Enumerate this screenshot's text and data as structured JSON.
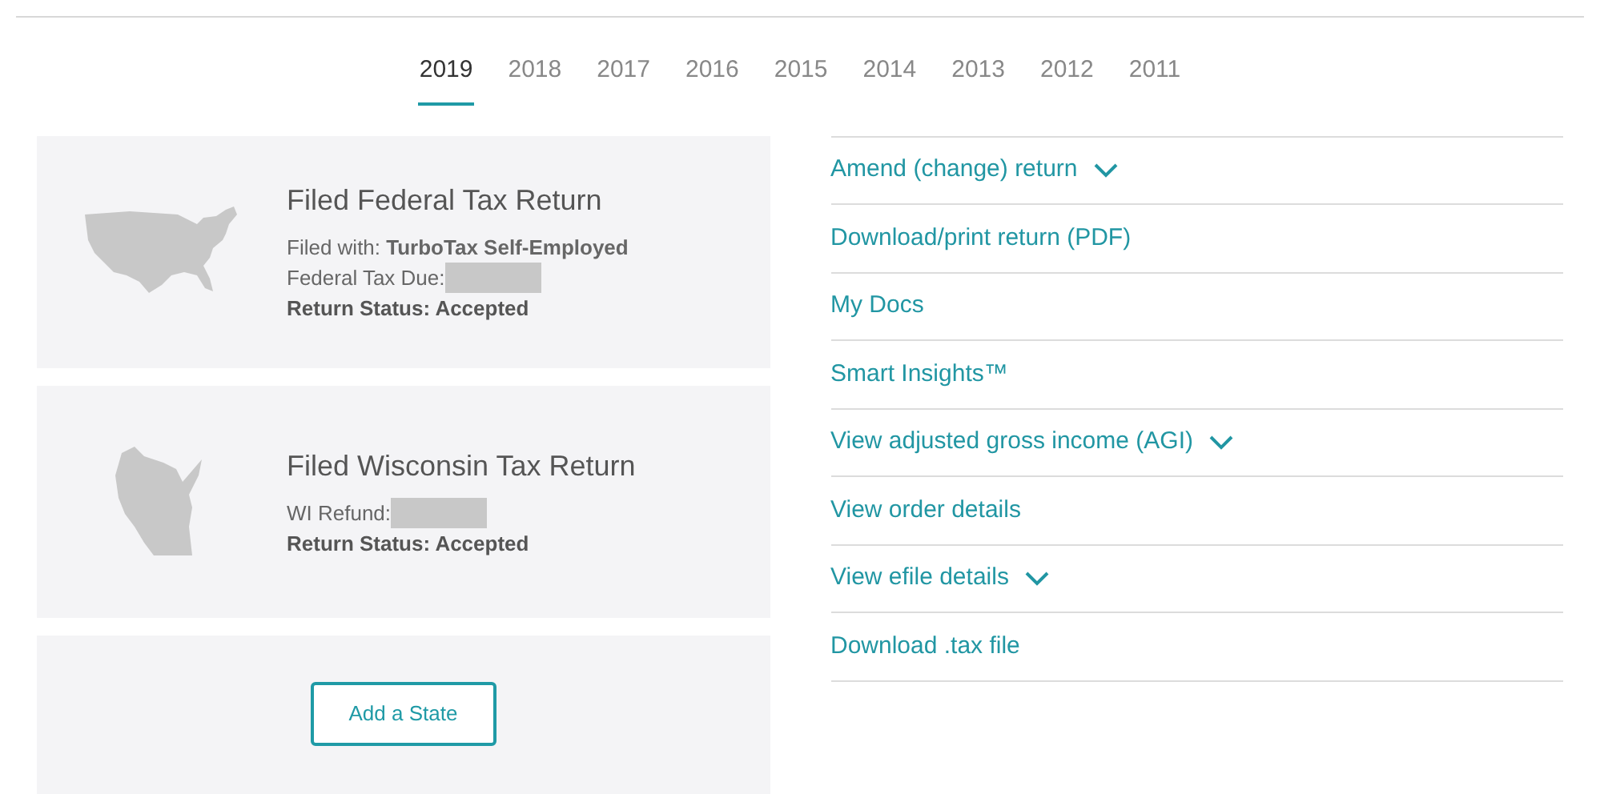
{
  "tabs": [
    {
      "label": "2019",
      "selected": true
    },
    {
      "label": "2018",
      "selected": false
    },
    {
      "label": "2017",
      "selected": false
    },
    {
      "label": "2016",
      "selected": false
    },
    {
      "label": "2015",
      "selected": false
    },
    {
      "label": "2014",
      "selected": false
    },
    {
      "label": "2013",
      "selected": false
    },
    {
      "label": "2012",
      "selected": false
    },
    {
      "label": "2011",
      "selected": false
    }
  ],
  "returns": [
    {
      "kind": "us",
      "title": "Filed Federal Tax Return",
      "lines": [
        {
          "kind": "text",
          "text": "Filed with: **TurboTax Self-Employed**"
        },
        {
          "kind": "redacted",
          "text": "Federal Tax Due:"
        },
        {
          "kind": "strong",
          "text": "Return Status: Accepted"
        }
      ]
    },
    {
      "kind": "wi",
      "title": "Filed Wisconsin Tax Return",
      "lines": [
        {
          "kind": "redacted",
          "text": "WI Refund:"
        },
        {
          "kind": "strong",
          "text": "Return Status: Accepted"
        }
      ]
    }
  ],
  "add_state_button": "Add a State",
  "links": [
    {
      "label": "Amend (change) return",
      "expandable": true
    },
    {
      "label": "Download/print return (PDF)",
      "expandable": false
    },
    {
      "label": "My Docs",
      "expandable": false
    },
    {
      "label": "Smart Insights™",
      "expandable": false
    },
    {
      "label": "View adjusted gross income (AGI)",
      "expandable": true
    },
    {
      "label": "View order details",
      "expandable": false
    },
    {
      "label": "View efile details",
      "expandable": true
    },
    {
      "label": "Download .tax file",
      "expandable": false
    }
  ]
}
